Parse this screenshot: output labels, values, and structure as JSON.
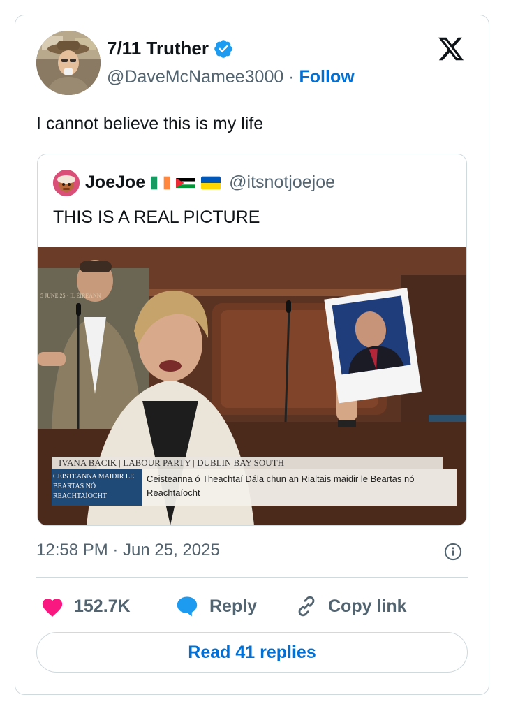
{
  "author": {
    "display_name": "7/11 Truther",
    "handle": "@DaveMcNamee3000",
    "separator": "·",
    "follow_label": "Follow",
    "verified": true
  },
  "tweet": {
    "text": "I cannot believe this is my life",
    "timestamp": "12:58 PM · Jun 25, 2025"
  },
  "quote": {
    "display_name": "JoeJoe",
    "handle": "@itsnotjoejoe",
    "flags": [
      "ireland-flag",
      "palestine-flag",
      "ukraine-flag"
    ],
    "text": "THIS IS A REAL PICTURE",
    "photo": {
      "lower_third_name": "IVANA BACIK | LABOUR PARTY | DUBLIN BAY SOUTH",
      "lower_third_tag": "CEISTEANNA MAIDIR LE BEARTAS NÓ REACHTAÍOCHT",
      "lower_third_caption": "Ceisteanna ó Theachtaí Dála chun an Rialtais maidir le Beartas nó Reachtaíocht",
      "corner_text": "5 JUNE 25 · IL ÉIREANN"
    }
  },
  "actions": {
    "like_count": "152.7K",
    "reply_label": "Reply",
    "copy_link_label": "Copy link",
    "read_replies_label": "Read 41 replies"
  },
  "colors": {
    "accent_blue": "#006fd6",
    "like_pink": "#f91880",
    "reply_blue": "#1d9bf0",
    "muted": "#536471",
    "border": "#cfd9de"
  }
}
